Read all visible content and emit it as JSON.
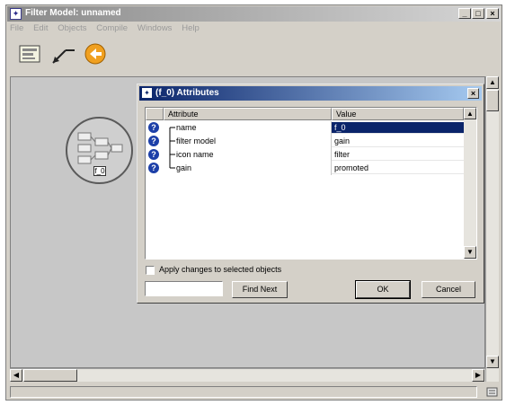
{
  "window": {
    "title": "Filter Model: unnamed",
    "controls": [
      "_",
      "□",
      "×"
    ]
  },
  "menu": [
    "File",
    "Edit",
    "Objects",
    "Compile",
    "Windows",
    "Help"
  ],
  "toolbar": {
    "tools": [
      "node-palette-icon",
      "link-tool-icon",
      "next-level-icon"
    ]
  },
  "canvas": {
    "node_label": "f_0"
  },
  "dialog": {
    "title": "(f_0) Attributes",
    "close": "×",
    "columns": [
      "Attribute",
      "Value"
    ],
    "rows": [
      {
        "attribute": "name",
        "value": "f_0",
        "selected": true
      },
      {
        "attribute": "filter model",
        "value": "gain",
        "selected": false
      },
      {
        "attribute": "icon name",
        "value": "filter",
        "selected": false
      },
      {
        "attribute": "gain",
        "value": "promoted",
        "selected": false
      }
    ],
    "apply_checkbox_label": "Apply changes to selected objects",
    "apply_checked": false,
    "find_input_value": "",
    "find_next_label": "Find Next",
    "ok_label": "OK",
    "cancel_label": "Cancel"
  }
}
